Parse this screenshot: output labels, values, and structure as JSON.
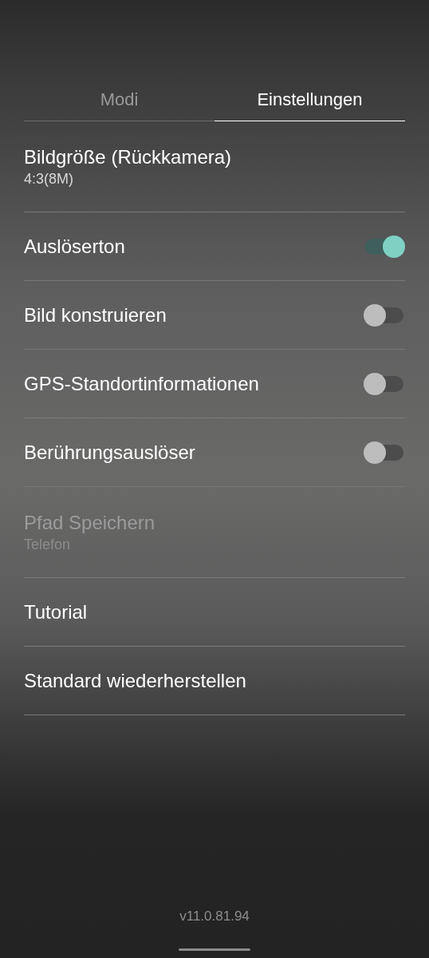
{
  "tabs": [
    {
      "label": "Modi",
      "selected": false
    },
    {
      "label": "Einstellungen",
      "selected": true
    }
  ],
  "settings": [
    {
      "kind": "detail",
      "title": "Bildgröße (Rückkamera)",
      "value": "4:3(8M)",
      "disabled": false
    },
    {
      "kind": "toggle",
      "title": "Auslöserton",
      "on": true
    },
    {
      "kind": "toggle",
      "title": "Bild konstruieren",
      "on": false
    },
    {
      "kind": "toggle",
      "title": "GPS-Standortinformationen",
      "on": false
    },
    {
      "kind": "toggle",
      "title": "Berührungsauslöser",
      "on": false
    },
    {
      "kind": "detail",
      "title": "Pfad Speichern",
      "value": "Telefon",
      "disabled": true
    },
    {
      "kind": "action",
      "title": "Tutorial"
    },
    {
      "kind": "action",
      "title": "Standard wiederherstellen"
    }
  ],
  "version": "v11.0.81.94"
}
